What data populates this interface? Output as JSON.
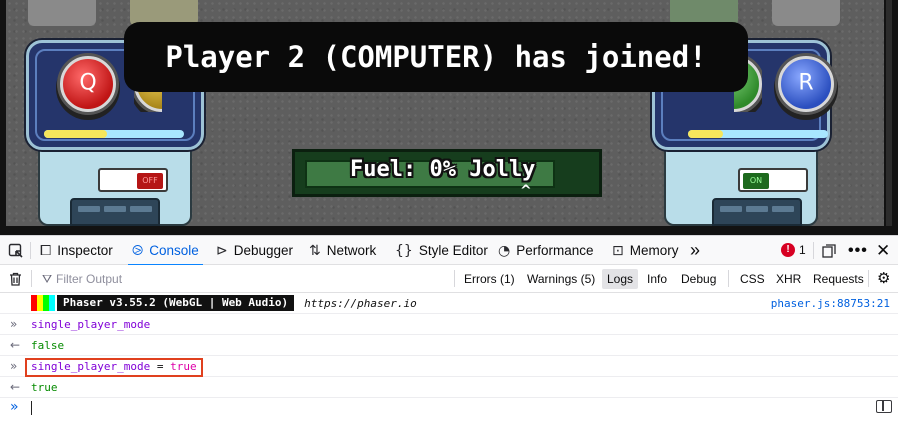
{
  "game": {
    "banner": "Player 2 (COMPUTER) has joined!",
    "fuel_label": "Fuel: 0% Jolly",
    "fuel_percent": 0,
    "caret": "^",
    "left_station": {
      "button_key": "Q",
      "toggle_label": "OFF",
      "meter_fraction": 0.45
    },
    "right_station": {
      "button_key": "R",
      "toggle_label": "ON",
      "meter_fraction": 0.25
    }
  },
  "devtools": {
    "tabs": [
      {
        "label": "Inspector",
        "icon": "inspector-icon"
      },
      {
        "label": "Console",
        "icon": "console-icon"
      },
      {
        "label": "Debugger",
        "icon": "debugger-icon"
      },
      {
        "label": "Network",
        "icon": "network-icon"
      },
      {
        "label": "Style Editor",
        "icon": "style-editor-icon"
      },
      {
        "label": "Performance",
        "icon": "performance-icon"
      },
      {
        "label": "Memory",
        "icon": "memory-icon"
      }
    ],
    "error_count": "1",
    "filter_placeholder": "Filter Output",
    "filters": {
      "errors": "Errors (1)",
      "warnings": "Warnings (5)",
      "logs": "Logs",
      "info": "Info",
      "debug": "Debug",
      "css": "CSS",
      "xhr": "XHR",
      "requests": "Requests"
    },
    "console": {
      "phaser_label": "Phaser v3.55.2 (WebGL | Web Audio)",
      "phaser_url": "https://phaser.io",
      "phaser_source": "phaser.js:88753:21",
      "entries": [
        {
          "kind": "input",
          "text": "single_player_mode"
        },
        {
          "kind": "result",
          "text": "false"
        },
        {
          "kind": "input",
          "text_lhs": "single_player_mode",
          "text_op": " = ",
          "text_rhs": "true"
        },
        {
          "kind": "result",
          "text": "true"
        }
      ]
    }
  }
}
